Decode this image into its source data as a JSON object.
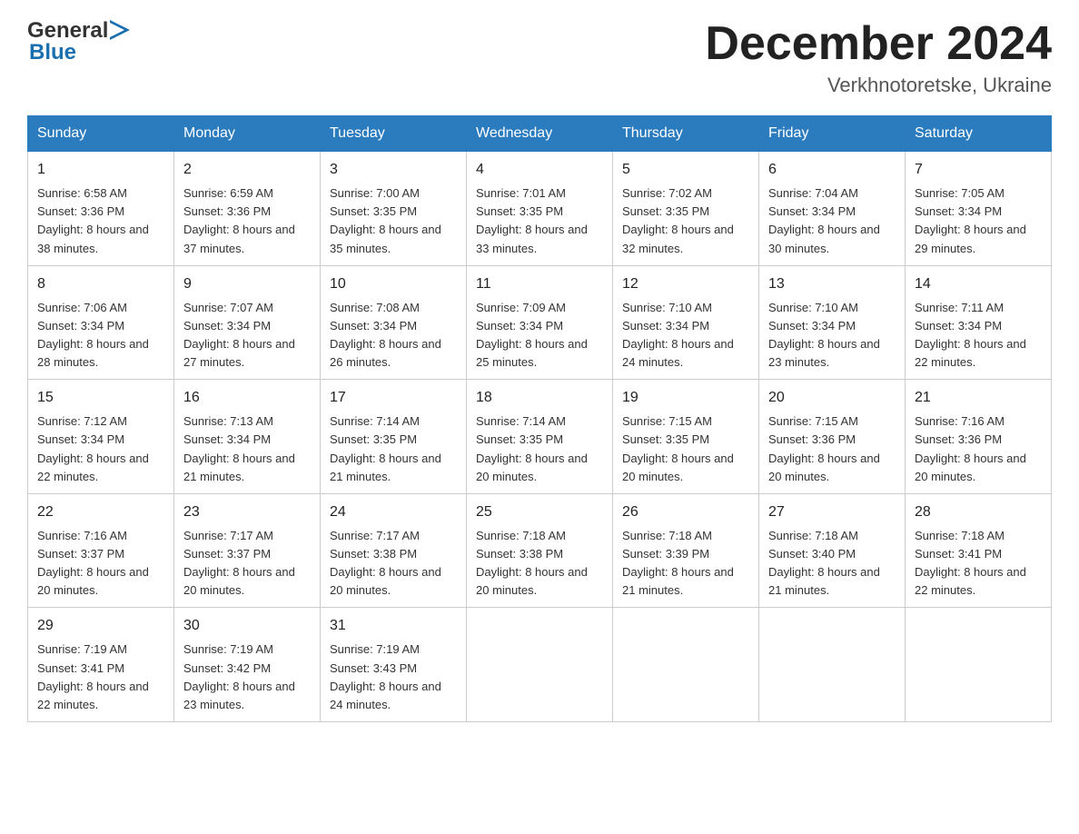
{
  "logo": {
    "text_general": "General",
    "text_blue": "Blue",
    "arrow_color": "#1a6faf"
  },
  "header": {
    "month": "December 2024",
    "location": "Verkhnotoretske, Ukraine"
  },
  "days_of_week": [
    "Sunday",
    "Monday",
    "Tuesday",
    "Wednesday",
    "Thursday",
    "Friday",
    "Saturday"
  ],
  "weeks": [
    [
      {
        "day": "1",
        "sunrise": "Sunrise: 6:58 AM",
        "sunset": "Sunset: 3:36 PM",
        "daylight": "Daylight: 8 hours and 38 minutes."
      },
      {
        "day": "2",
        "sunrise": "Sunrise: 6:59 AM",
        "sunset": "Sunset: 3:36 PM",
        "daylight": "Daylight: 8 hours and 37 minutes."
      },
      {
        "day": "3",
        "sunrise": "Sunrise: 7:00 AM",
        "sunset": "Sunset: 3:35 PM",
        "daylight": "Daylight: 8 hours and 35 minutes."
      },
      {
        "day": "4",
        "sunrise": "Sunrise: 7:01 AM",
        "sunset": "Sunset: 3:35 PM",
        "daylight": "Daylight: 8 hours and 33 minutes."
      },
      {
        "day": "5",
        "sunrise": "Sunrise: 7:02 AM",
        "sunset": "Sunset: 3:35 PM",
        "daylight": "Daylight: 8 hours and 32 minutes."
      },
      {
        "day": "6",
        "sunrise": "Sunrise: 7:04 AM",
        "sunset": "Sunset: 3:34 PM",
        "daylight": "Daylight: 8 hours and 30 minutes."
      },
      {
        "day": "7",
        "sunrise": "Sunrise: 7:05 AM",
        "sunset": "Sunset: 3:34 PM",
        "daylight": "Daylight: 8 hours and 29 minutes."
      }
    ],
    [
      {
        "day": "8",
        "sunrise": "Sunrise: 7:06 AM",
        "sunset": "Sunset: 3:34 PM",
        "daylight": "Daylight: 8 hours and 28 minutes."
      },
      {
        "day": "9",
        "sunrise": "Sunrise: 7:07 AM",
        "sunset": "Sunset: 3:34 PM",
        "daylight": "Daylight: 8 hours and 27 minutes."
      },
      {
        "day": "10",
        "sunrise": "Sunrise: 7:08 AM",
        "sunset": "Sunset: 3:34 PM",
        "daylight": "Daylight: 8 hours and 26 minutes."
      },
      {
        "day": "11",
        "sunrise": "Sunrise: 7:09 AM",
        "sunset": "Sunset: 3:34 PM",
        "daylight": "Daylight: 8 hours and 25 minutes."
      },
      {
        "day": "12",
        "sunrise": "Sunrise: 7:10 AM",
        "sunset": "Sunset: 3:34 PM",
        "daylight": "Daylight: 8 hours and 24 minutes."
      },
      {
        "day": "13",
        "sunrise": "Sunrise: 7:10 AM",
        "sunset": "Sunset: 3:34 PM",
        "daylight": "Daylight: 8 hours and 23 minutes."
      },
      {
        "day": "14",
        "sunrise": "Sunrise: 7:11 AM",
        "sunset": "Sunset: 3:34 PM",
        "daylight": "Daylight: 8 hours and 22 minutes."
      }
    ],
    [
      {
        "day": "15",
        "sunrise": "Sunrise: 7:12 AM",
        "sunset": "Sunset: 3:34 PM",
        "daylight": "Daylight: 8 hours and 22 minutes."
      },
      {
        "day": "16",
        "sunrise": "Sunrise: 7:13 AM",
        "sunset": "Sunset: 3:34 PM",
        "daylight": "Daylight: 8 hours and 21 minutes."
      },
      {
        "day": "17",
        "sunrise": "Sunrise: 7:14 AM",
        "sunset": "Sunset: 3:35 PM",
        "daylight": "Daylight: 8 hours and 21 minutes."
      },
      {
        "day": "18",
        "sunrise": "Sunrise: 7:14 AM",
        "sunset": "Sunset: 3:35 PM",
        "daylight": "Daylight: 8 hours and 20 minutes."
      },
      {
        "day": "19",
        "sunrise": "Sunrise: 7:15 AM",
        "sunset": "Sunset: 3:35 PM",
        "daylight": "Daylight: 8 hours and 20 minutes."
      },
      {
        "day": "20",
        "sunrise": "Sunrise: 7:15 AM",
        "sunset": "Sunset: 3:36 PM",
        "daylight": "Daylight: 8 hours and 20 minutes."
      },
      {
        "day": "21",
        "sunrise": "Sunrise: 7:16 AM",
        "sunset": "Sunset: 3:36 PM",
        "daylight": "Daylight: 8 hours and 20 minutes."
      }
    ],
    [
      {
        "day": "22",
        "sunrise": "Sunrise: 7:16 AM",
        "sunset": "Sunset: 3:37 PM",
        "daylight": "Daylight: 8 hours and 20 minutes."
      },
      {
        "day": "23",
        "sunrise": "Sunrise: 7:17 AM",
        "sunset": "Sunset: 3:37 PM",
        "daylight": "Daylight: 8 hours and 20 minutes."
      },
      {
        "day": "24",
        "sunrise": "Sunrise: 7:17 AM",
        "sunset": "Sunset: 3:38 PM",
        "daylight": "Daylight: 8 hours and 20 minutes."
      },
      {
        "day": "25",
        "sunrise": "Sunrise: 7:18 AM",
        "sunset": "Sunset: 3:38 PM",
        "daylight": "Daylight: 8 hours and 20 minutes."
      },
      {
        "day": "26",
        "sunrise": "Sunrise: 7:18 AM",
        "sunset": "Sunset: 3:39 PM",
        "daylight": "Daylight: 8 hours and 21 minutes."
      },
      {
        "day": "27",
        "sunrise": "Sunrise: 7:18 AM",
        "sunset": "Sunset: 3:40 PM",
        "daylight": "Daylight: 8 hours and 21 minutes."
      },
      {
        "day": "28",
        "sunrise": "Sunrise: 7:18 AM",
        "sunset": "Sunset: 3:41 PM",
        "daylight": "Daylight: 8 hours and 22 minutes."
      }
    ],
    [
      {
        "day": "29",
        "sunrise": "Sunrise: 7:19 AM",
        "sunset": "Sunset: 3:41 PM",
        "daylight": "Daylight: 8 hours and 22 minutes."
      },
      {
        "day": "30",
        "sunrise": "Sunrise: 7:19 AM",
        "sunset": "Sunset: 3:42 PM",
        "daylight": "Daylight: 8 hours and 23 minutes."
      },
      {
        "day": "31",
        "sunrise": "Sunrise: 7:19 AM",
        "sunset": "Sunset: 3:43 PM",
        "daylight": "Daylight: 8 hours and 24 minutes."
      },
      null,
      null,
      null,
      null
    ]
  ]
}
